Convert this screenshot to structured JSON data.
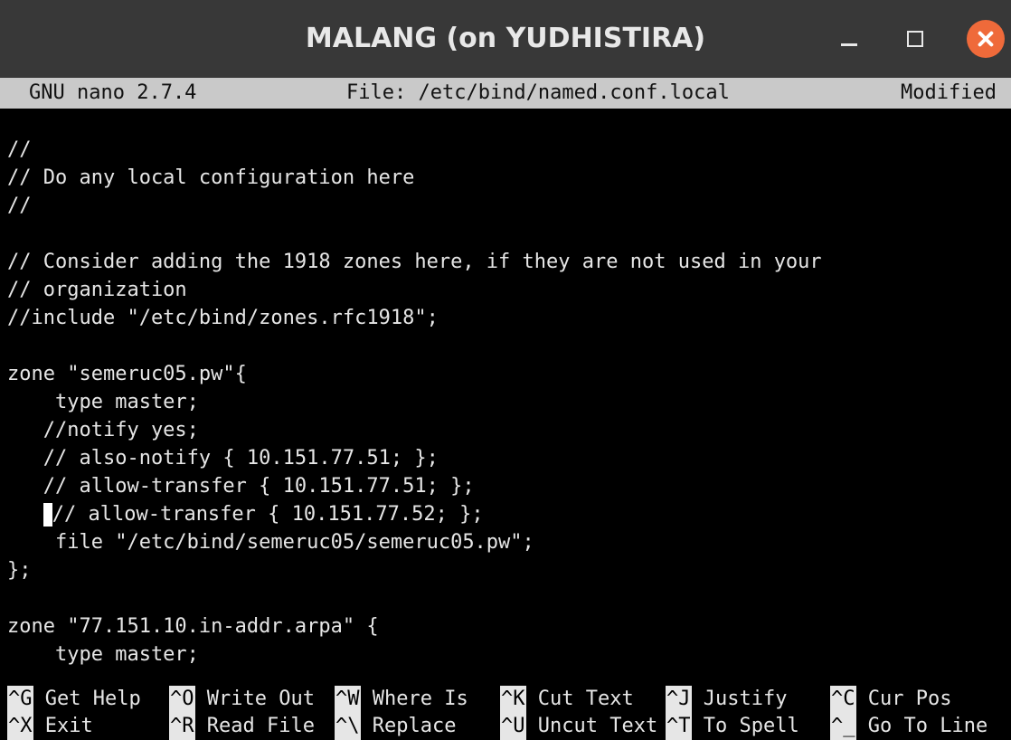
{
  "window": {
    "title": "MALANG (on YUDHISTIRA)"
  },
  "nano": {
    "version": "GNU nano 2.7.4",
    "file": "File: /etc/bind/named.conf.local",
    "status": "Modified"
  },
  "editor": {
    "lines": [
      "//",
      "// Do any local configuration here",
      "//",
      "",
      "// Consider adding the 1918 zones here, if they are not used in your",
      "// organization",
      "//include \"/etc/bind/zones.rfc1918\";",
      "",
      "zone \"semeruc05.pw\"{",
      "    type master;",
      "   //notify yes;",
      "   // also-notify { 10.151.77.51; };",
      "   // allow-transfer { 10.151.77.51; };",
      "// allow-transfer { 10.151.77.52; };",
      "    file \"/etc/bind/semeruc05/semeruc05.pw\";",
      "};",
      "",
      "zone \"77.151.10.in-addr.arpa\" {",
      "    type master;"
    ]
  },
  "shortcuts": {
    "row1": [
      {
        "key": "^G",
        "label": "Get Help"
      },
      {
        "key": "^O",
        "label": "Write Out"
      },
      {
        "key": "^W",
        "label": "Where Is"
      },
      {
        "key": "^K",
        "label": "Cut Text"
      },
      {
        "key": "^J",
        "label": "Justify"
      },
      {
        "key": "^C",
        "label": "Cur Pos"
      }
    ],
    "row2": [
      {
        "key": "^X",
        "label": "Exit"
      },
      {
        "key": "^R",
        "label": "Read File"
      },
      {
        "key": "^\\",
        "label": "Replace"
      },
      {
        "key": "^U",
        "label": "Uncut Text"
      },
      {
        "key": "^T",
        "label": "To Spell"
      },
      {
        "key": "^_",
        "label": "Go To Line"
      }
    ]
  }
}
